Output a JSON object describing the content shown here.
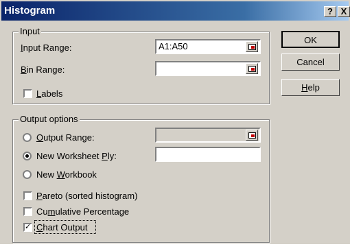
{
  "window": {
    "title": "Histogram",
    "help_glyph": "?",
    "close_glyph": "X"
  },
  "input": {
    "legend": "Input",
    "input_range_label": "Input Range:",
    "input_range_value": "A1:A50",
    "bin_range_label": "Bin Range:",
    "bin_range_value": "",
    "labels_label": "Labels",
    "labels_checked": false
  },
  "output": {
    "legend": "Output options",
    "output_range_label": "Output Range:",
    "output_range_value": "",
    "new_worksheet_label": "New Worksheet Ply:",
    "new_worksheet_value": "",
    "new_workbook_label": "New Workbook",
    "selected_option": "new_worksheet",
    "pareto_label": "Pareto (sorted histogram)",
    "pareto_checked": false,
    "cumulative_label": "Cumulative Percentage",
    "cumulative_checked": false,
    "chart_output_label": "Chart Output",
    "chart_output_checked": true,
    "check_glyph": "✓"
  },
  "buttons": {
    "ok": "OK",
    "cancel": "Cancel",
    "help": "Help"
  }
}
